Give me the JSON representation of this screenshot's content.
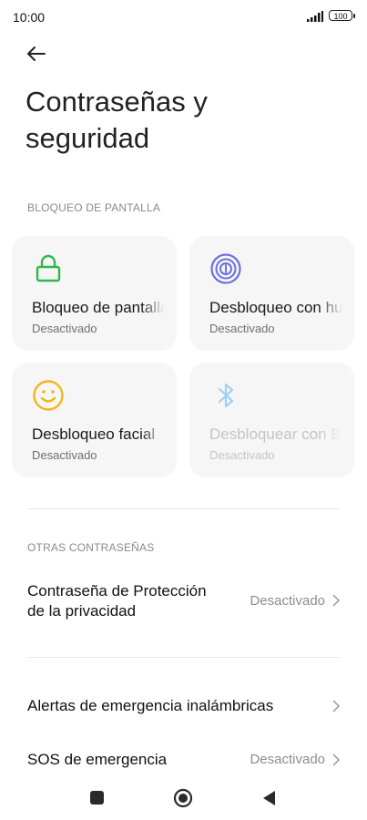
{
  "status_bar": {
    "time": "10:00",
    "battery": "100"
  },
  "page": {
    "title": "Contraseñas y seguridad"
  },
  "screen_lock": {
    "section_label": "BLOQUEO DE PANTALLA",
    "tiles": [
      {
        "title": "Bloqueo de pantalla",
        "subtitle": "Desactivado",
        "icon": "lock-icon",
        "color": "#2db84c"
      },
      {
        "title": "Desbloqueo con huella",
        "subtitle": "Desactivado",
        "icon": "fingerprint-icon",
        "color": "#6c6fe0"
      },
      {
        "title": "Desbloqueo facial",
        "subtitle": "Desactivado",
        "icon": "smile-icon",
        "color": "#f3b617"
      },
      {
        "title": "Desbloquear con Bluetooth",
        "subtitle": "Desactivado",
        "icon": "bluetooth-icon",
        "color": "#9fd0f3"
      }
    ]
  },
  "other_passwords": {
    "section_label": "OTRAS CONTRASEÑAS",
    "privacy_row": {
      "title_line1": "Contraseña de Protección",
      "title_line2": "de la privacidad",
      "value": "Desactivado"
    }
  },
  "emergency": {
    "wireless_alerts": {
      "title": "Alertas de emergencia inalámbricas"
    },
    "sos": {
      "title": "SOS de emergencia",
      "value": "Desactivado"
    }
  }
}
